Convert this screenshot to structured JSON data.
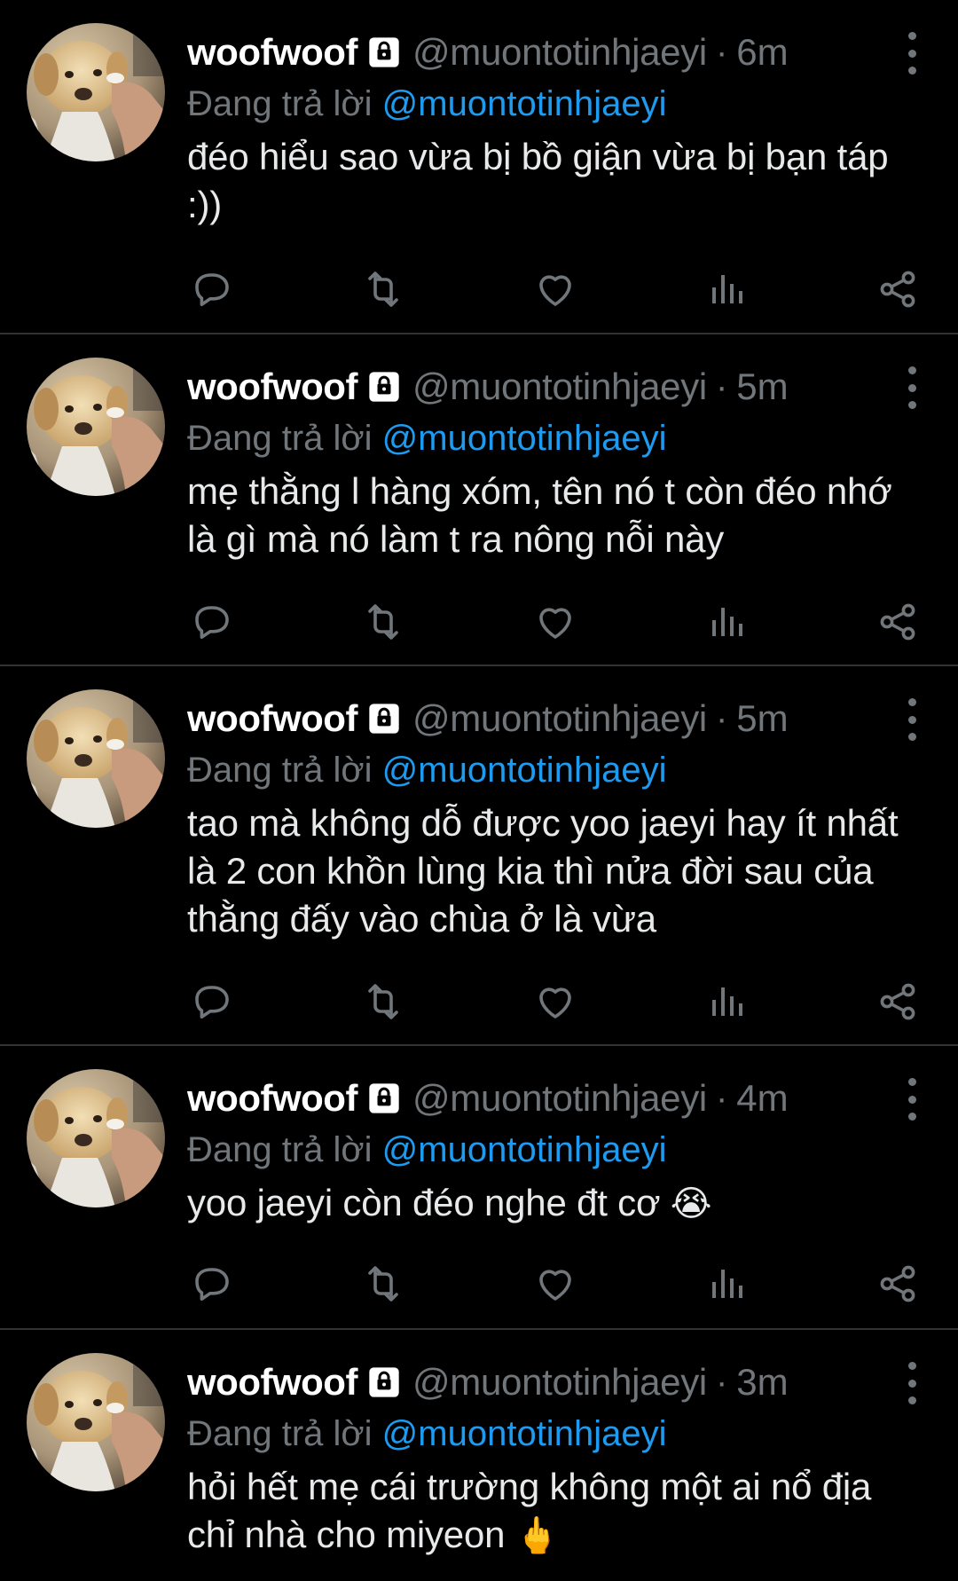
{
  "theme": {
    "background": "#000000",
    "divider": "#2f3336",
    "secondary_text": "#71767b",
    "mention": "#1d9bf0",
    "primary_text": "#e7e9ea"
  },
  "tweets": [
    {
      "display_name": "woofwoof",
      "handle": "@muontotinhjaeyi",
      "time": "6m",
      "reply_prefix": "Đang trả lời",
      "reply_to": "@muontotinhjaeyi",
      "text": "đéo hiểu sao vừa bị bồ giận vừa bị bạn táp :))",
      "emoji": ""
    },
    {
      "display_name": "woofwoof",
      "handle": "@muontotinhjaeyi",
      "time": "5m",
      "reply_prefix": "Đang trả lời",
      "reply_to": "@muontotinhjaeyi",
      "text": "mẹ thằng l hàng xóm, tên nó t còn đéo nhớ là gì mà nó làm t ra nông nỗi này",
      "emoji": ""
    },
    {
      "display_name": "woofwoof",
      "handle": "@muontotinhjaeyi",
      "time": "5m",
      "reply_prefix": "Đang trả lời",
      "reply_to": "@muontotinhjaeyi",
      "text": "tao mà không dỗ được yoo jaeyi hay ít nhất là 2 con khồn lùng kia thì nửa đời sau của thằng đấy vào chùa ở là vừa",
      "emoji": ""
    },
    {
      "display_name": "woofwoof",
      "handle": "@muontotinhjaeyi",
      "time": "4m",
      "reply_prefix": "Đang trả lời",
      "reply_to": "@muontotinhjaeyi",
      "text": "yoo jaeyi còn đéo nghe đt cơ ",
      "emoji": "😭"
    },
    {
      "display_name": "woofwoof",
      "handle": "@muontotinhjaeyi",
      "time": "3m",
      "reply_prefix": "Đang trả lời",
      "reply_to": "@muontotinhjaeyi",
      "text": "hỏi hết mẹ cái trường không một ai nổ địa chỉ nhà cho miyeon ",
      "emoji": "🖕"
    }
  ],
  "actions": [
    "reply-icon",
    "retweet-icon",
    "like-icon",
    "views-icon",
    "share-icon"
  ]
}
